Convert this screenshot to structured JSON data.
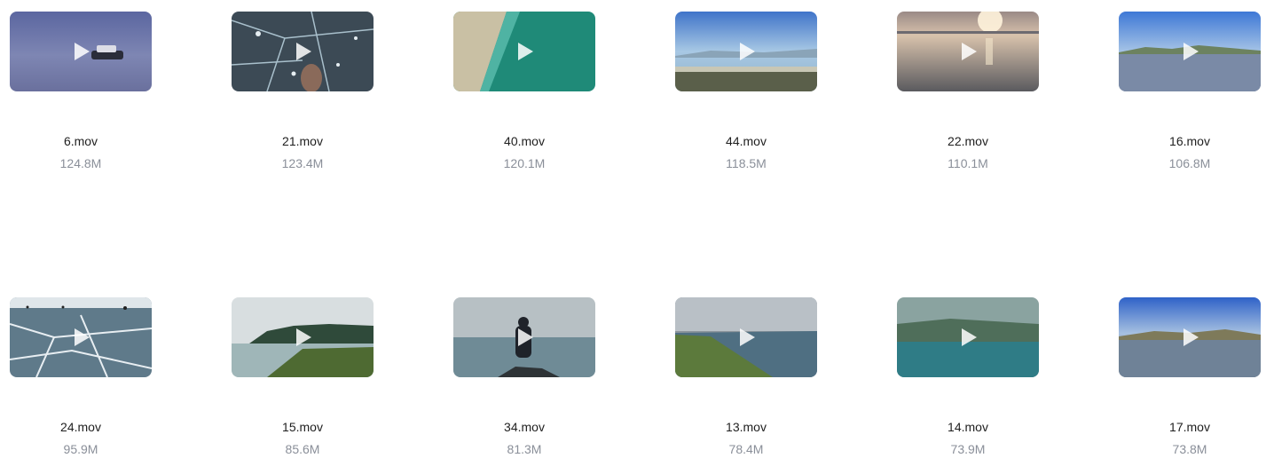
{
  "videos": [
    {
      "name": "6.mov",
      "size": "124.8M",
      "scene": "hovercraft-on-ice"
    },
    {
      "name": "21.mov",
      "size": "123.4M",
      "scene": "clear-ice-bubbles"
    },
    {
      "name": "40.mov",
      "size": "120.1M",
      "scene": "turquoise-shore-aerial"
    },
    {
      "name": "44.mov",
      "size": "118.5M",
      "scene": "lake-pier"
    },
    {
      "name": "22.mov",
      "size": "110.1M",
      "scene": "sunset-ice"
    },
    {
      "name": "16.mov",
      "size": "106.8M",
      "scene": "blue-lake-hills"
    },
    {
      "name": "24.mov",
      "size": "95.9M",
      "scene": "cracked-ice-people"
    },
    {
      "name": "15.mov",
      "size": "85.6M",
      "scene": "forest-peninsula"
    },
    {
      "name": "34.mov",
      "size": "81.3M",
      "scene": "person-on-ice"
    },
    {
      "name": "13.mov",
      "size": "78.4M",
      "scene": "cloudy-shore"
    },
    {
      "name": "14.mov",
      "size": "73.9M",
      "scene": "teal-lake-forest"
    },
    {
      "name": "17.mov",
      "size": "73.8M",
      "scene": "blue-lake-shore"
    }
  ],
  "icons": {
    "play": "play-icon"
  }
}
